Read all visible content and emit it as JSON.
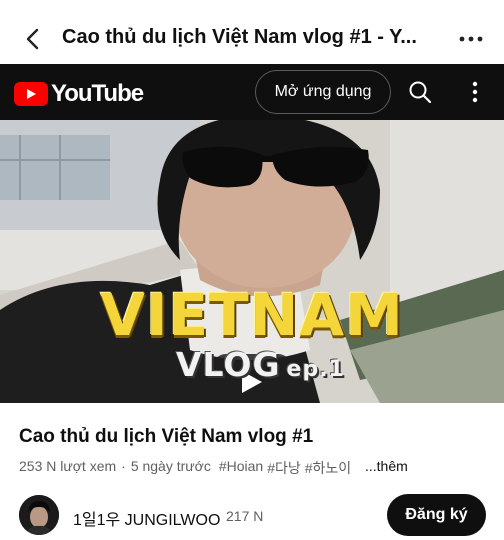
{
  "browser": {
    "title": "Cao thủ du lịch Việt Nam vlog #1 - Y...",
    "back_icon": "chevron-left-icon",
    "more_icon": "more-horizontal-icon"
  },
  "header": {
    "brand": "YouTube",
    "open_app_label": "Mở ứng dụng",
    "search_icon": "search-icon",
    "menu_icon": "more-vertical-icon",
    "brand_color": "#ff0000",
    "background": "#0f0f0f"
  },
  "video": {
    "thumbnail_title": "VIETNAM",
    "thumbnail_subtitle": "VLOG",
    "thumbnail_episode": "ep.1",
    "play_icon": "play-icon"
  },
  "info": {
    "title": "Cao thủ du lịch Việt Nam vlog #1",
    "views": "253 N lượt xem",
    "separator": "·",
    "uploaded": "5 ngày trước",
    "tags": [
      "#Hoian",
      "#다낭",
      "#하노이"
    ],
    "more_label": "...thêm"
  },
  "channel": {
    "name": "1일1우 JUNGILWOO",
    "subscribers": "217 N",
    "subscribe_label": "Đăng ký"
  }
}
